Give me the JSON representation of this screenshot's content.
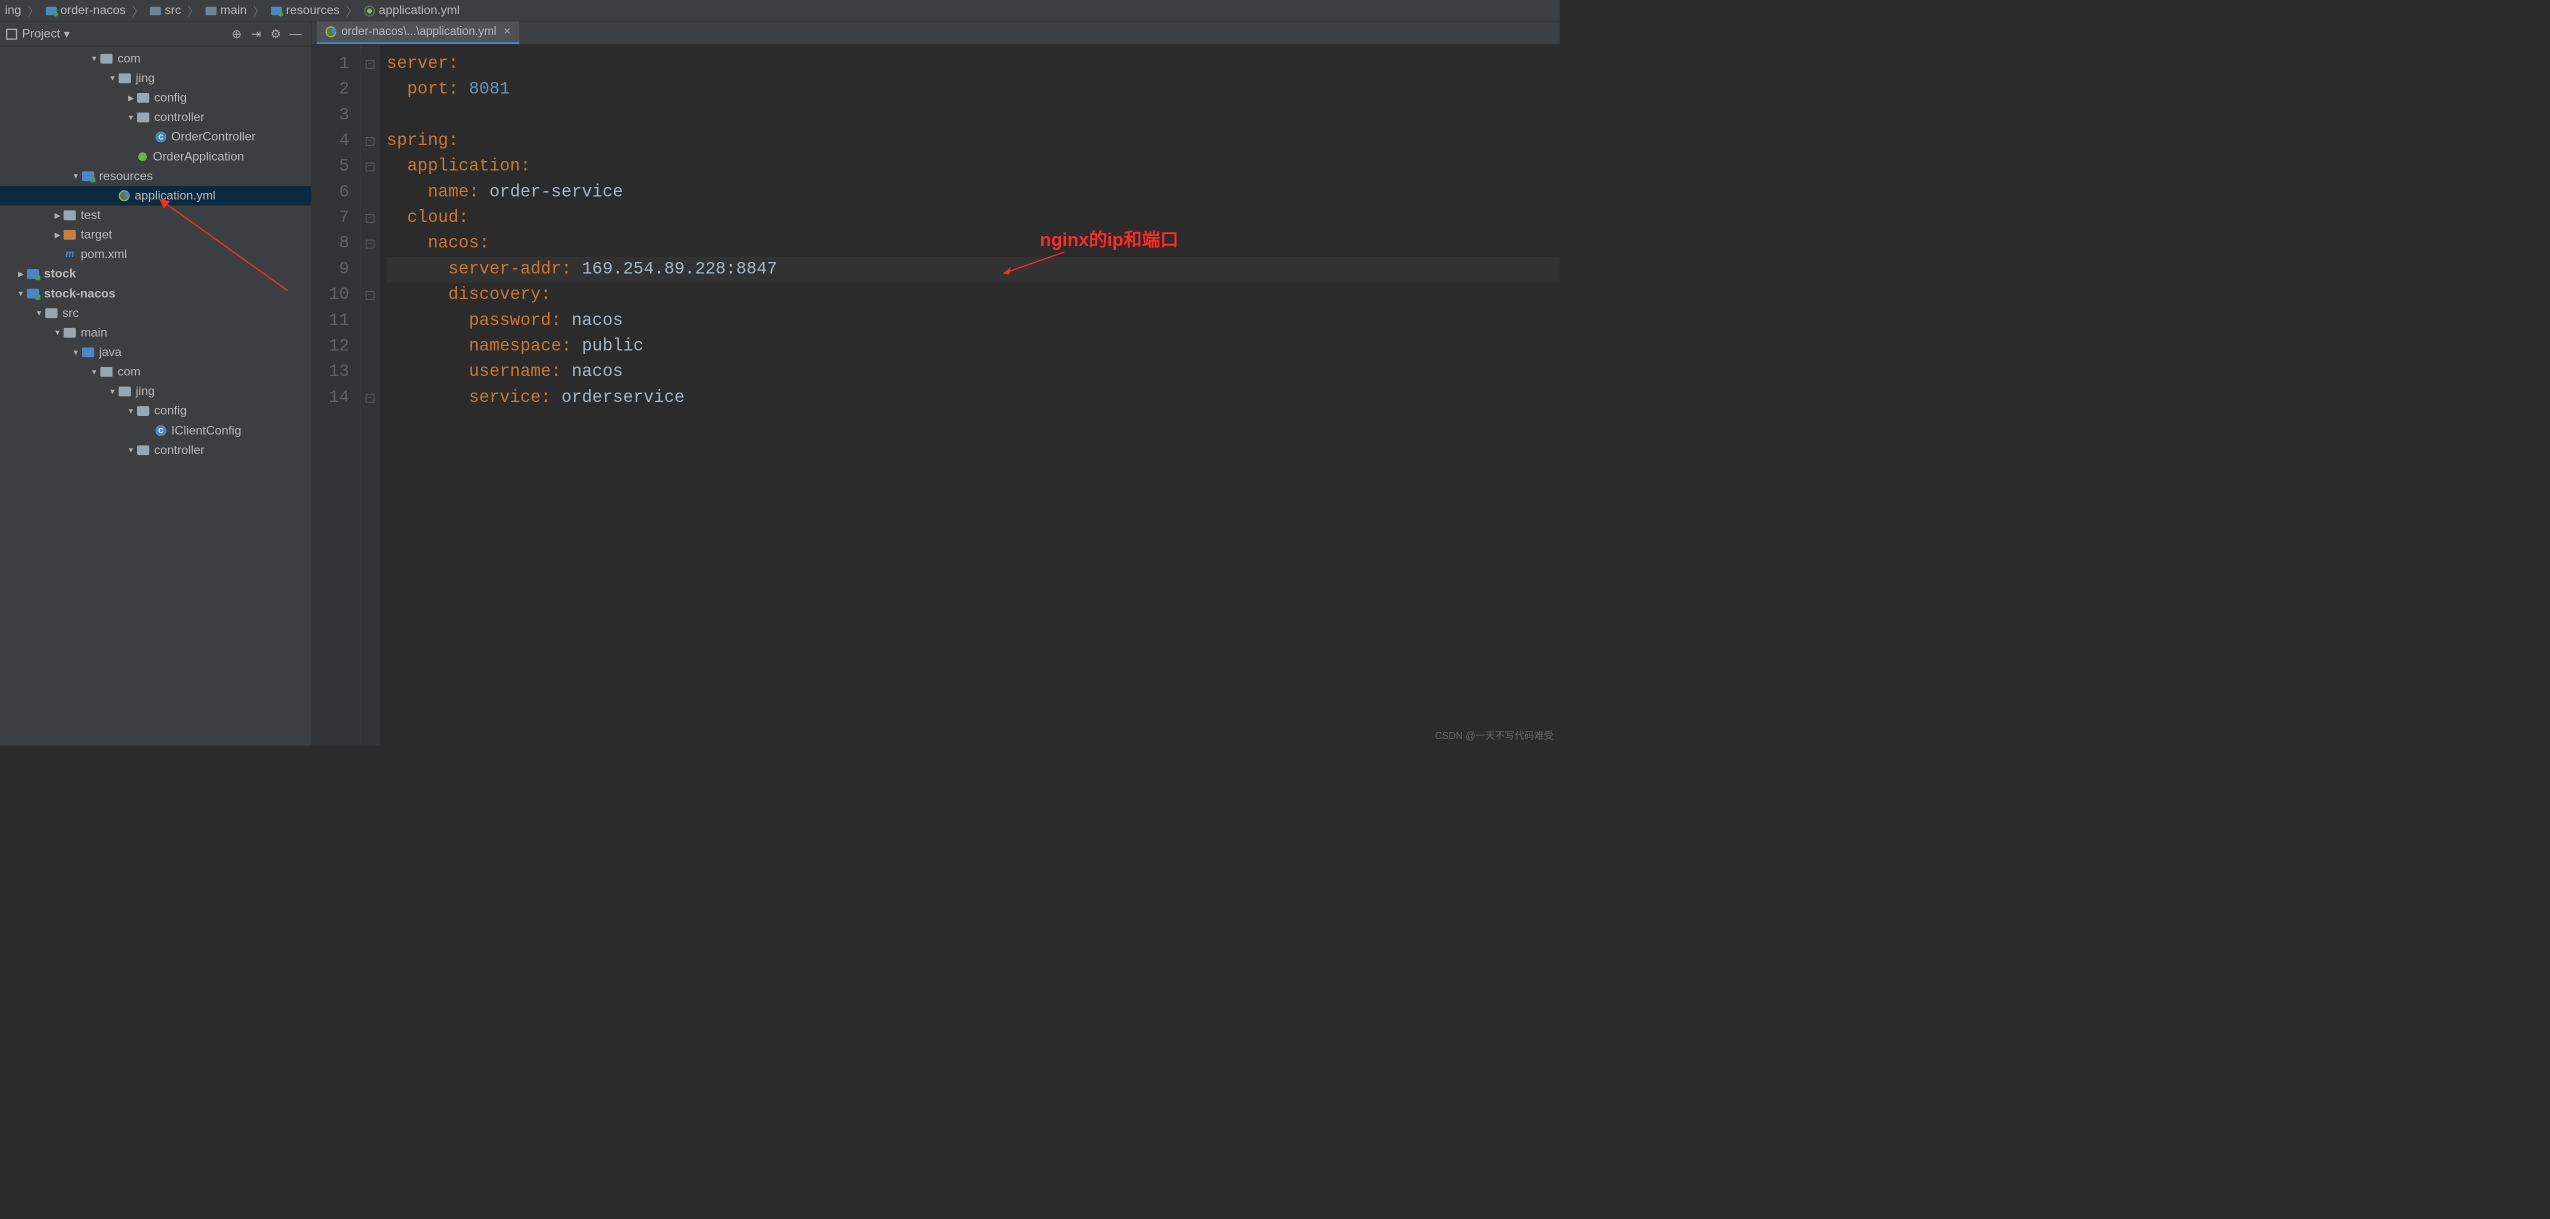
{
  "breadcrumb": [
    {
      "icon": "",
      "label": "ing"
    },
    {
      "icon": "module",
      "label": "order-nacos"
    },
    {
      "icon": "dir-blue",
      "label": "src"
    },
    {
      "icon": "dir-blue",
      "label": "main"
    },
    {
      "icon": "module",
      "label": "resources"
    },
    {
      "icon": "yml",
      "label": "application.yml"
    }
  ],
  "sidebar": {
    "title": "Project",
    "tree": [
      {
        "indent": 120,
        "arrow": "down",
        "icon": "dir",
        "label": "com"
      },
      {
        "indent": 150,
        "arrow": "down",
        "icon": "dir",
        "label": "jing"
      },
      {
        "indent": 180,
        "arrow": "right",
        "icon": "dir",
        "label": "config"
      },
      {
        "indent": 180,
        "arrow": "down",
        "icon": "dir",
        "label": "controller"
      },
      {
        "indent": 210,
        "arrow": "",
        "icon": "class",
        "label": "OrderController"
      },
      {
        "indent": 180,
        "arrow": "",
        "icon": "spring",
        "label": "OrderApplication"
      },
      {
        "indent": 90,
        "arrow": "down",
        "icon": "module",
        "label": "resources"
      },
      {
        "indent": 150,
        "arrow": "",
        "icon": "yml2",
        "label": "application.yml",
        "selected": true
      },
      {
        "indent": 60,
        "arrow": "right",
        "icon": "dir",
        "label": "test"
      },
      {
        "indent": 60,
        "arrow": "right",
        "icon": "dir-orange",
        "label": "target"
      },
      {
        "indent": 60,
        "arrow": "",
        "icon": "maven",
        "label": "pom.xml",
        "iconText": "m"
      },
      {
        "indent": 0,
        "arrow": "right",
        "icon": "module",
        "label": "stock",
        "bold": true
      },
      {
        "indent": 0,
        "arrow": "down",
        "icon": "module",
        "label": "stock-nacos",
        "bold": true
      },
      {
        "indent": 30,
        "arrow": "down",
        "icon": "dir",
        "label": "src"
      },
      {
        "indent": 60,
        "arrow": "down",
        "icon": "dir",
        "label": "main"
      },
      {
        "indent": 90,
        "arrow": "down",
        "icon": "dir-blue",
        "label": "java"
      },
      {
        "indent": 120,
        "arrow": "down",
        "icon": "dir",
        "label": "com"
      },
      {
        "indent": 150,
        "arrow": "down",
        "icon": "dir",
        "label": "jing"
      },
      {
        "indent": 180,
        "arrow": "down",
        "icon": "dir",
        "label": "config"
      },
      {
        "indent": 210,
        "arrow": "",
        "icon": "class",
        "label": "IClientConfig"
      },
      {
        "indent": 180,
        "arrow": "down",
        "icon": "dir",
        "label": "controller"
      }
    ]
  },
  "editor": {
    "tab": "order-nacos\\...\\application.yml",
    "lines": [
      {
        "n": 1,
        "fold": "open",
        "tokens": [
          {
            "t": "server",
            "c": "k"
          },
          {
            "t": ":",
            "c": "k"
          }
        ]
      },
      {
        "n": 2,
        "fold": "",
        "tokens": [
          {
            "t": "  ",
            "c": ""
          },
          {
            "t": "port",
            "c": "k"
          },
          {
            "t": ": ",
            "c": "k"
          },
          {
            "t": "8081",
            "c": "n"
          }
        ]
      },
      {
        "n": 3,
        "fold": "",
        "tokens": []
      },
      {
        "n": 4,
        "fold": "open",
        "tokens": [
          {
            "t": "spring",
            "c": "k"
          },
          {
            "t": ":",
            "c": "k"
          }
        ]
      },
      {
        "n": 5,
        "fold": "open",
        "tokens": [
          {
            "t": "  ",
            "c": ""
          },
          {
            "t": "application",
            "c": "k"
          },
          {
            "t": ":",
            "c": "k"
          }
        ]
      },
      {
        "n": 6,
        "fold": "",
        "tokens": [
          {
            "t": "    ",
            "c": ""
          },
          {
            "t": "name",
            "c": "k"
          },
          {
            "t": ": ",
            "c": "k"
          },
          {
            "t": "order-service",
            "c": "v"
          }
        ]
      },
      {
        "n": 7,
        "fold": "open",
        "tokens": [
          {
            "t": "  ",
            "c": ""
          },
          {
            "t": "cloud",
            "c": "k"
          },
          {
            "t": ":",
            "c": "k"
          }
        ]
      },
      {
        "n": 8,
        "fold": "open",
        "tokens": [
          {
            "t": "    ",
            "c": ""
          },
          {
            "t": "nacos",
            "c": "k"
          },
          {
            "t": ":",
            "c": "k"
          }
        ]
      },
      {
        "n": 9,
        "fold": "",
        "hl": true,
        "tokens": [
          {
            "t": "      ",
            "c": ""
          },
          {
            "t": "server-addr",
            "c": "k"
          },
          {
            "t": ": ",
            "c": "k"
          },
          {
            "t": "169.254.89.228:8847",
            "c": "v"
          }
        ]
      },
      {
        "n": 10,
        "fold": "open",
        "tokens": [
          {
            "t": "      ",
            "c": ""
          },
          {
            "t": "discovery",
            "c": "k"
          },
          {
            "t": ":",
            "c": "k"
          }
        ]
      },
      {
        "n": 11,
        "fold": "",
        "tokens": [
          {
            "t": "        ",
            "c": ""
          },
          {
            "t": "password",
            "c": "k"
          },
          {
            "t": ": ",
            "c": "k"
          },
          {
            "t": "nacos",
            "c": "v"
          }
        ]
      },
      {
        "n": 12,
        "fold": "",
        "tokens": [
          {
            "t": "        ",
            "c": ""
          },
          {
            "t": "namespace",
            "c": "k"
          },
          {
            "t": ": ",
            "c": "k"
          },
          {
            "t": "public",
            "c": "v"
          }
        ]
      },
      {
        "n": 13,
        "fold": "",
        "tokens": [
          {
            "t": "        ",
            "c": ""
          },
          {
            "t": "username",
            "c": "k"
          },
          {
            "t": ": ",
            "c": "k"
          },
          {
            "t": "nacos",
            "c": "v"
          }
        ]
      },
      {
        "n": 14,
        "fold": "open",
        "tokens": [
          {
            "t": "        ",
            "c": ""
          },
          {
            "t": "service",
            "c": "k"
          },
          {
            "t": ": ",
            "c": "k"
          },
          {
            "t": "orderservice",
            "c": "v"
          }
        ]
      }
    ]
  },
  "annotation": {
    "text": "nginx的ip和端口"
  },
  "watermark": "CSDN @一天不写代码难受"
}
